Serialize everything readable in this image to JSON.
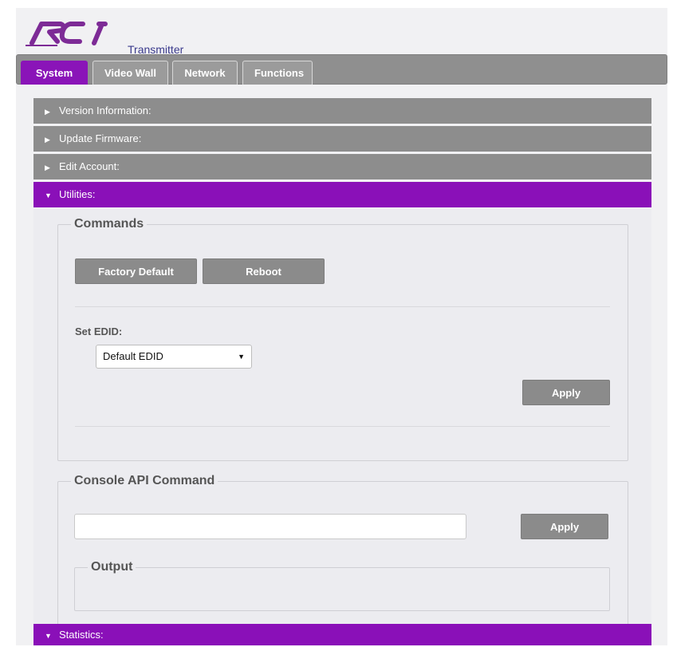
{
  "header": {
    "logo_text": "RTI",
    "app_title": "Transmitter"
  },
  "tabs": [
    {
      "label": "System",
      "active": true
    },
    {
      "label": "Video Wall",
      "active": false
    },
    {
      "label": "Network",
      "active": false
    },
    {
      "label": "Functions",
      "active": false
    }
  ],
  "accordion": [
    {
      "label": "Version Information:",
      "expanded": false
    },
    {
      "label": "Update Firmware:",
      "expanded": false
    },
    {
      "label": "Edit Account:",
      "expanded": false
    },
    {
      "label": "Utilities:",
      "expanded": true
    },
    {
      "label": "Statistics:",
      "expanded": true
    }
  ],
  "commands": {
    "legend": "Commands",
    "factory_default_label": "Factory Default",
    "reboot_label": "Reboot",
    "set_edid_label": "Set EDID:",
    "edid_selected": "Default EDID",
    "apply_label": "Apply"
  },
  "console": {
    "legend": "Console API Command",
    "input_value": "",
    "apply_label": "Apply",
    "output_legend": "Output"
  },
  "colors": {
    "accent": "#8a10b8",
    "header_gray": "#8d8d8d",
    "title_blue": "#3a3a8c"
  },
  "icons": {
    "collapsed": "triangle-right-icon",
    "expanded": "triangle-down-icon",
    "dropdown": "chevron-down-icon"
  }
}
